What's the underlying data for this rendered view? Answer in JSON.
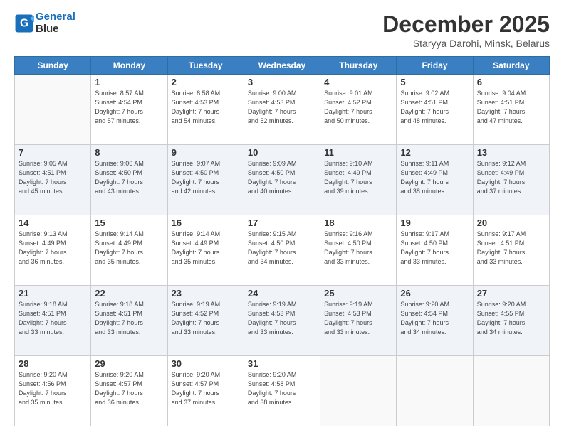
{
  "logo": {
    "line1": "General",
    "line2": "Blue"
  },
  "title": "December 2025",
  "subtitle": "Staryya Darohi, Minsk, Belarus",
  "days_of_week": [
    "Sunday",
    "Monday",
    "Tuesday",
    "Wednesday",
    "Thursday",
    "Friday",
    "Saturday"
  ],
  "weeks": [
    [
      {
        "day": "",
        "info": ""
      },
      {
        "day": "1",
        "info": "Sunrise: 8:57 AM\nSunset: 4:54 PM\nDaylight: 7 hours\nand 57 minutes."
      },
      {
        "day": "2",
        "info": "Sunrise: 8:58 AM\nSunset: 4:53 PM\nDaylight: 7 hours\nand 54 minutes."
      },
      {
        "day": "3",
        "info": "Sunrise: 9:00 AM\nSunset: 4:53 PM\nDaylight: 7 hours\nand 52 minutes."
      },
      {
        "day": "4",
        "info": "Sunrise: 9:01 AM\nSunset: 4:52 PM\nDaylight: 7 hours\nand 50 minutes."
      },
      {
        "day": "5",
        "info": "Sunrise: 9:02 AM\nSunset: 4:51 PM\nDaylight: 7 hours\nand 48 minutes."
      },
      {
        "day": "6",
        "info": "Sunrise: 9:04 AM\nSunset: 4:51 PM\nDaylight: 7 hours\nand 47 minutes."
      }
    ],
    [
      {
        "day": "7",
        "info": "Sunrise: 9:05 AM\nSunset: 4:51 PM\nDaylight: 7 hours\nand 45 minutes."
      },
      {
        "day": "8",
        "info": "Sunrise: 9:06 AM\nSunset: 4:50 PM\nDaylight: 7 hours\nand 43 minutes."
      },
      {
        "day": "9",
        "info": "Sunrise: 9:07 AM\nSunset: 4:50 PM\nDaylight: 7 hours\nand 42 minutes."
      },
      {
        "day": "10",
        "info": "Sunrise: 9:09 AM\nSunset: 4:50 PM\nDaylight: 7 hours\nand 40 minutes."
      },
      {
        "day": "11",
        "info": "Sunrise: 9:10 AM\nSunset: 4:49 PM\nDaylight: 7 hours\nand 39 minutes."
      },
      {
        "day": "12",
        "info": "Sunrise: 9:11 AM\nSunset: 4:49 PM\nDaylight: 7 hours\nand 38 minutes."
      },
      {
        "day": "13",
        "info": "Sunrise: 9:12 AM\nSunset: 4:49 PM\nDaylight: 7 hours\nand 37 minutes."
      }
    ],
    [
      {
        "day": "14",
        "info": "Sunrise: 9:13 AM\nSunset: 4:49 PM\nDaylight: 7 hours\nand 36 minutes."
      },
      {
        "day": "15",
        "info": "Sunrise: 9:14 AM\nSunset: 4:49 PM\nDaylight: 7 hours\nand 35 minutes."
      },
      {
        "day": "16",
        "info": "Sunrise: 9:14 AM\nSunset: 4:49 PM\nDaylight: 7 hours\nand 35 minutes."
      },
      {
        "day": "17",
        "info": "Sunrise: 9:15 AM\nSunset: 4:50 PM\nDaylight: 7 hours\nand 34 minutes."
      },
      {
        "day": "18",
        "info": "Sunrise: 9:16 AM\nSunset: 4:50 PM\nDaylight: 7 hours\nand 33 minutes."
      },
      {
        "day": "19",
        "info": "Sunrise: 9:17 AM\nSunset: 4:50 PM\nDaylight: 7 hours\nand 33 minutes."
      },
      {
        "day": "20",
        "info": "Sunrise: 9:17 AM\nSunset: 4:51 PM\nDaylight: 7 hours\nand 33 minutes."
      }
    ],
    [
      {
        "day": "21",
        "info": "Sunrise: 9:18 AM\nSunset: 4:51 PM\nDaylight: 7 hours\nand 33 minutes."
      },
      {
        "day": "22",
        "info": "Sunrise: 9:18 AM\nSunset: 4:51 PM\nDaylight: 7 hours\nand 33 minutes."
      },
      {
        "day": "23",
        "info": "Sunrise: 9:19 AM\nSunset: 4:52 PM\nDaylight: 7 hours\nand 33 minutes."
      },
      {
        "day": "24",
        "info": "Sunrise: 9:19 AM\nSunset: 4:53 PM\nDaylight: 7 hours\nand 33 minutes."
      },
      {
        "day": "25",
        "info": "Sunrise: 9:19 AM\nSunset: 4:53 PM\nDaylight: 7 hours\nand 33 minutes."
      },
      {
        "day": "26",
        "info": "Sunrise: 9:20 AM\nSunset: 4:54 PM\nDaylight: 7 hours\nand 34 minutes."
      },
      {
        "day": "27",
        "info": "Sunrise: 9:20 AM\nSunset: 4:55 PM\nDaylight: 7 hours\nand 34 minutes."
      }
    ],
    [
      {
        "day": "28",
        "info": "Sunrise: 9:20 AM\nSunset: 4:56 PM\nDaylight: 7 hours\nand 35 minutes."
      },
      {
        "day": "29",
        "info": "Sunrise: 9:20 AM\nSunset: 4:57 PM\nDaylight: 7 hours\nand 36 minutes."
      },
      {
        "day": "30",
        "info": "Sunrise: 9:20 AM\nSunset: 4:57 PM\nDaylight: 7 hours\nand 37 minutes."
      },
      {
        "day": "31",
        "info": "Sunrise: 9:20 AM\nSunset: 4:58 PM\nDaylight: 7 hours\nand 38 minutes."
      },
      {
        "day": "",
        "info": ""
      },
      {
        "day": "",
        "info": ""
      },
      {
        "day": "",
        "info": ""
      }
    ]
  ]
}
